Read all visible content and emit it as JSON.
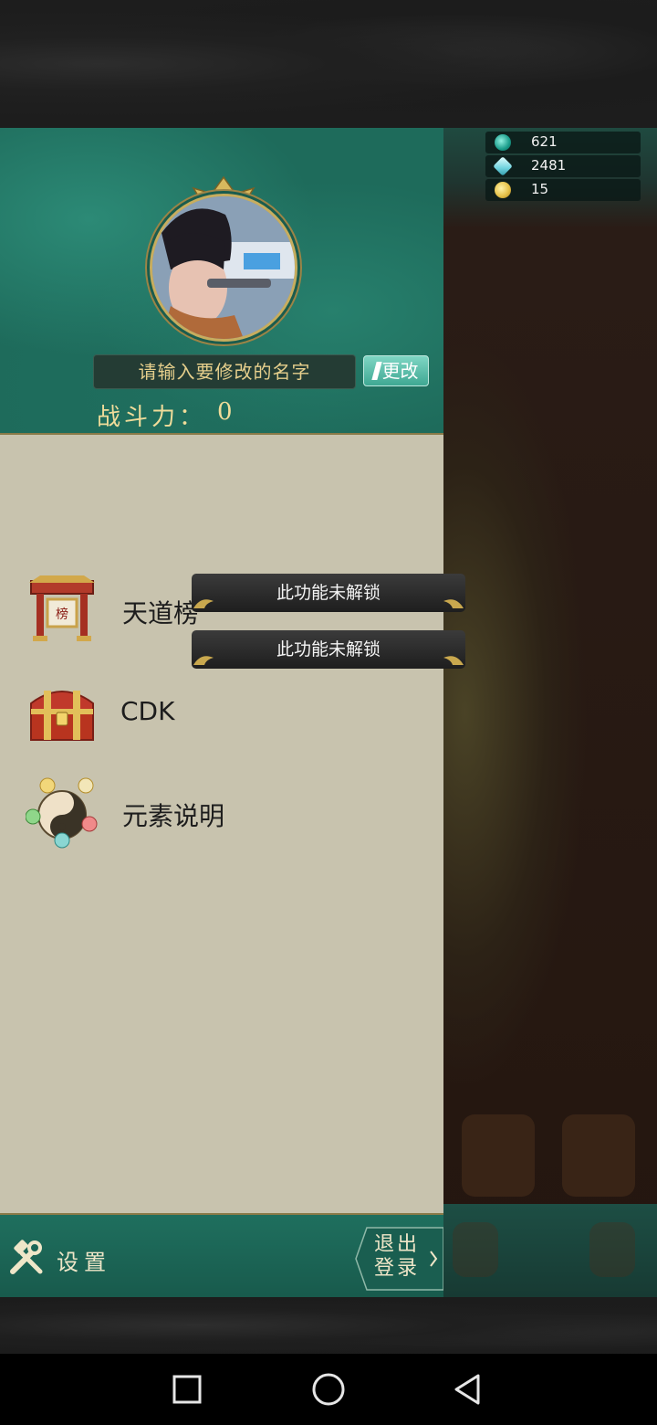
{
  "resources": [
    {
      "icon": "jade-orb-icon",
      "value": "621",
      "color": "#3fc7b4"
    },
    {
      "icon": "crystal-icon",
      "value": "2481",
      "color": "#8fe3e8"
    },
    {
      "icon": "gold-nugget-icon",
      "value": "15",
      "color": "#e6c24a"
    }
  ],
  "profile": {
    "name_placeholder": "请输入要修改的名字",
    "change_label": "更改",
    "power_label": "战斗力：",
    "power_value": "0"
  },
  "menu": {
    "items": [
      {
        "label": "天道榜",
        "icon": "leaderboard-gate-icon"
      },
      {
        "label": "CDK",
        "icon": "treasure-chest-icon"
      },
      {
        "label": "元素说明",
        "icon": "yin-yang-elements-icon"
      }
    ]
  },
  "toasts": [
    "此功能未解锁",
    "此功能未解锁"
  ],
  "footer": {
    "settings_label": "设置",
    "logout_label": "退出登录"
  },
  "colors": {
    "panel_teal": "#1e6b5b",
    "panel_beige": "#c8c3ae",
    "gold_text": "#f0dc9a"
  }
}
